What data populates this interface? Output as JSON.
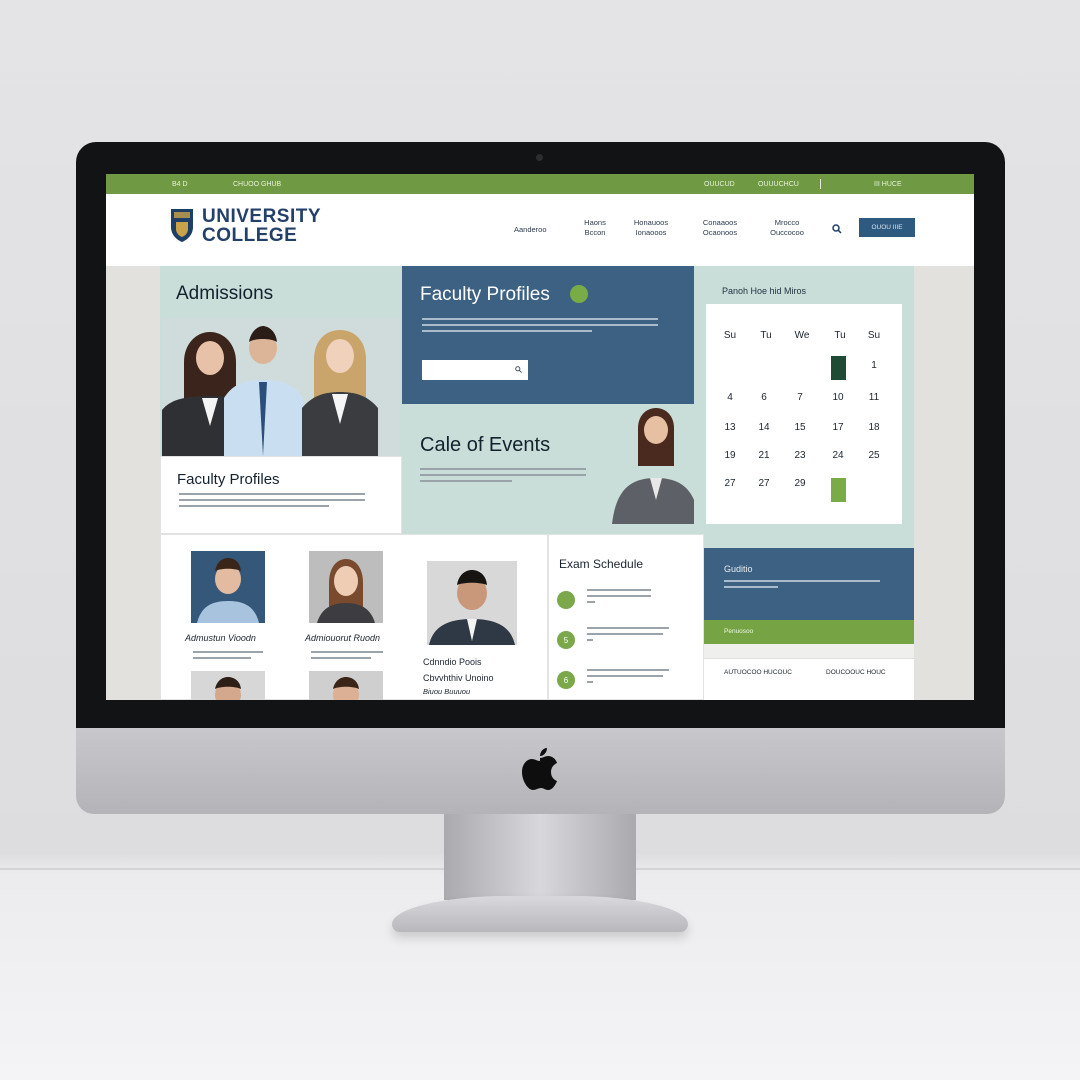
{
  "topbar": {
    "left_a": "B4 D",
    "left_b": "CHUOO GHUB",
    "right_a": "OUUCUD",
    "right_b": "OUUUCHCU",
    "right_c": "III HUCE"
  },
  "brand": {
    "line1": "UNIVERSITY",
    "line2": "COLLEGE",
    "shield_colors": {
      "primary": "#1f3e66",
      "accent": "#c9a24a"
    }
  },
  "nav": {
    "items": [
      {
        "label": "Aanderoo"
      },
      {
        "label": "Haons Bccon"
      },
      {
        "label": "Honauoos Ionaooos"
      },
      {
        "label": "Conaaoos Ocaonoos"
      },
      {
        "label": "Mrocco Ouccocoo"
      }
    ],
    "cta_label": "OUOU IIIE"
  },
  "admissions": {
    "title": "Admissions"
  },
  "faculty_card": {
    "title": "Faculty Profiles"
  },
  "faculty_panel": {
    "title": "Faculty Profiles",
    "search_placeholder": ""
  },
  "events": {
    "title": "Cale of Events"
  },
  "calendar": {
    "header": "Panoh Hoe hid Miros",
    "weekdays": [
      "Su",
      "Tu",
      "We",
      "Tu",
      "Su"
    ],
    "rows": [
      [
        "",
        "",
        "",
        "",
        "1"
      ],
      [
        "4",
        "6",
        "7",
        "10",
        "11"
      ],
      [
        "13",
        "14",
        "15",
        "17",
        "18"
      ],
      [
        "19",
        "21",
        "23",
        "24",
        "25"
      ],
      [
        "27",
        "27",
        "29",
        "",
        ""
      ]
    ],
    "highlight_colors": {
      "dark": "#1f4a33",
      "green": "#79ab46"
    }
  },
  "people": {
    "names": [
      "Admustun Vioodn",
      "Admiouorut Ruodn",
      "Cdnndio Poois"
    ],
    "subtitles": [
      "",
      "",
      "Cbvvhthiv Unoino",
      "Biuou Buuuou"
    ]
  },
  "exam": {
    "title": "Exam Schedule",
    "items": [
      {
        "marker": ""
      },
      {
        "marker": "5"
      },
      {
        "marker": "6"
      }
    ]
  },
  "guide": {
    "title": "Guditio",
    "bar_label": "Penuosoo",
    "footer_a": "AUTUOCOO HUCOUC",
    "footer_b": "DOUCOOUC HOUC"
  },
  "theme": {
    "green": "#6f9a43",
    "navy": "#3d6182",
    "mint": "#c9ddd9"
  }
}
